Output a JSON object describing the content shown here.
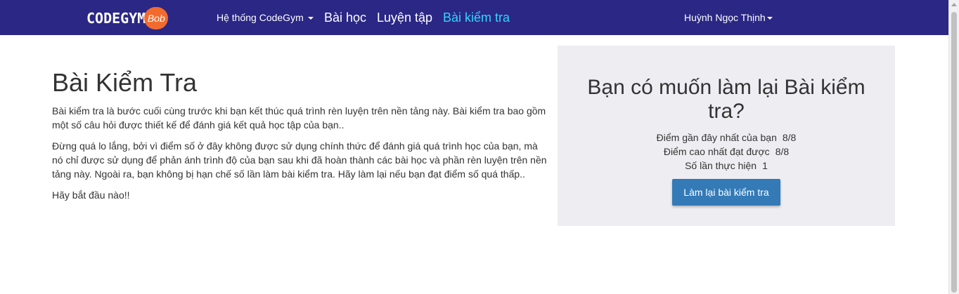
{
  "navbar": {
    "logo_text": "CODEGYM",
    "logo_badge": "Bob",
    "items": [
      {
        "label": "Hệ thống CodeGym",
        "has_caret": true
      },
      {
        "label": "Bài học"
      },
      {
        "label": "Luyện tập"
      },
      {
        "label": "Bài kiểm tra",
        "active": true
      }
    ],
    "user_name": "Huỳnh Ngọc Thịnh",
    "bg_color": "#2a2785",
    "active_color": "#33d4ff"
  },
  "main": {
    "title": "Bài Kiểm Tra",
    "paragraphs": [
      "Bài kiểm tra là bước cuối cùng trước khi bạn kết thúc quá trình rèn luyện trên nền tảng này. Bài kiểm tra bao gồm một số câu hỏi được thiết kế để đánh giá kết quả học tập của bạn..",
      "Đừng quá lo lắng, bởi vì điểm số ở đây không được sử dụng chính thức để đánh giá quá trình học của bạn, mà nó chỉ được sử dụng để phản ánh trình độ của bạn sau khi đã hoàn thành các bài học và phần rèn luyện trên nền tảng này. Ngoài ra, bạn không bị hạn chế số lần làm bài kiểm tra. Hãy làm lại nếu bạn đạt điểm số quá thấp..",
      "Hãy bắt đầu nào!!"
    ]
  },
  "panel": {
    "title": "Bạn có muốn làm lại Bài kiểm tra?",
    "stats": [
      {
        "label": "Điểm gần đây nhất của bạn",
        "value": "8/8"
      },
      {
        "label": "Điểm cao nhất đạt được",
        "value": "8/8"
      },
      {
        "label": "Số lần thực hiện",
        "value": "1"
      }
    ],
    "button_label": "Làm lại bài kiểm tra",
    "button_color": "#337ab7"
  }
}
